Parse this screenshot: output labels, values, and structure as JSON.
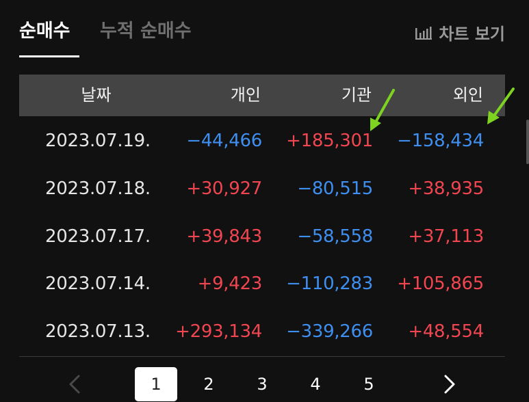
{
  "tabs": [
    {
      "label": "순매수",
      "active": true
    },
    {
      "label": "누적 순매수",
      "active": false
    }
  ],
  "chart_button": {
    "label": "차트 보기",
    "icon": "bar-chart-icon"
  },
  "table": {
    "headers": [
      "날짜",
      "개인",
      "기관",
      "외인"
    ],
    "rows": [
      {
        "date": "2023.07.19.",
        "individual": "−44,466",
        "institution": "+185,301",
        "foreign": "−158,434"
      },
      {
        "date": "2023.07.18.",
        "individual": "+30,927",
        "institution": "−80,515",
        "foreign": "+38,935"
      },
      {
        "date": "2023.07.17.",
        "individual": "+39,843",
        "institution": "−58,558",
        "foreign": "+37,113"
      },
      {
        "date": "2023.07.14.",
        "individual": "+9,423",
        "institution": "−110,283",
        "foreign": "+105,865"
      },
      {
        "date": "2023.07.13.",
        "individual": "+293,134",
        "institution": "−339,266",
        "foreign": "+48,554"
      }
    ]
  },
  "pagination": {
    "pages": [
      "1",
      "2",
      "3",
      "4",
      "5"
    ],
    "current": "1",
    "prev_icon": "chevron-left-icon",
    "next_icon": "chevron-right-icon"
  },
  "colors": {
    "positive": "#f04651",
    "negative": "#3f8ff0",
    "annotation_arrow": "#7ed321"
  }
}
